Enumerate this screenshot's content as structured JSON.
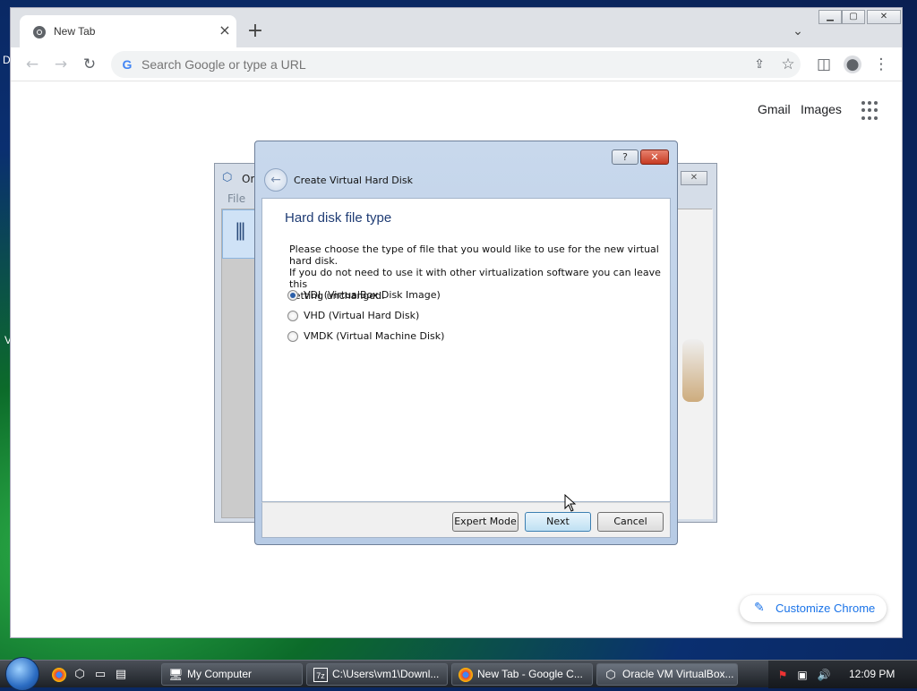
{
  "desktop": {
    "edge_char_1": "D",
    "edge_char_2": "V"
  },
  "chrome": {
    "tab_title": "New Tab",
    "omnibox_placeholder": "Search Google or type a URL",
    "ntp_links": {
      "gmail": "Gmail",
      "images": "Images"
    },
    "customize_label": "Customize Chrome",
    "window_buttons": {
      "minimize": "▁",
      "maximize": "▢",
      "close": "✕"
    }
  },
  "vbox_manager": {
    "title": "Ora",
    "menu_file": "File"
  },
  "dialog": {
    "title": "Create Virtual Hard Disk",
    "heading": "Hard disk file type",
    "description_lines": [
      "Please choose the type of file that you would like to use for the new virtual hard disk.",
      "If you do not need to use it with other virtualization software you can leave this",
      "setting unchanged."
    ],
    "options": [
      {
        "label": "VDI (VirtualBox Disk Image)",
        "selected": true
      },
      {
        "label": "VHD (Virtual Hard Disk)",
        "selected": false
      },
      {
        "label": "VMDK (Virtual Machine Disk)",
        "selected": false
      }
    ],
    "buttons": {
      "expert": "Expert Mode",
      "next": "Next",
      "cancel": "Cancel",
      "help": "?",
      "close": "✕"
    }
  },
  "taskbar": {
    "tasks": [
      {
        "label": "My Computer",
        "icon": "computer-icon"
      },
      {
        "label": "C:\\Users\\vm1\\Downl...",
        "icon": "7zip-icon"
      },
      {
        "label": "New Tab - Google C...",
        "icon": "chrome-icon"
      },
      {
        "label": "Oracle VM VirtualBox...",
        "icon": "virtualbox-icon"
      }
    ],
    "clock": "12:09 PM"
  },
  "colors": {
    "accent_blue": "#1a73e8",
    "dialog_heading": "#1f3c74",
    "taskbar_dark": "#1d2126"
  }
}
